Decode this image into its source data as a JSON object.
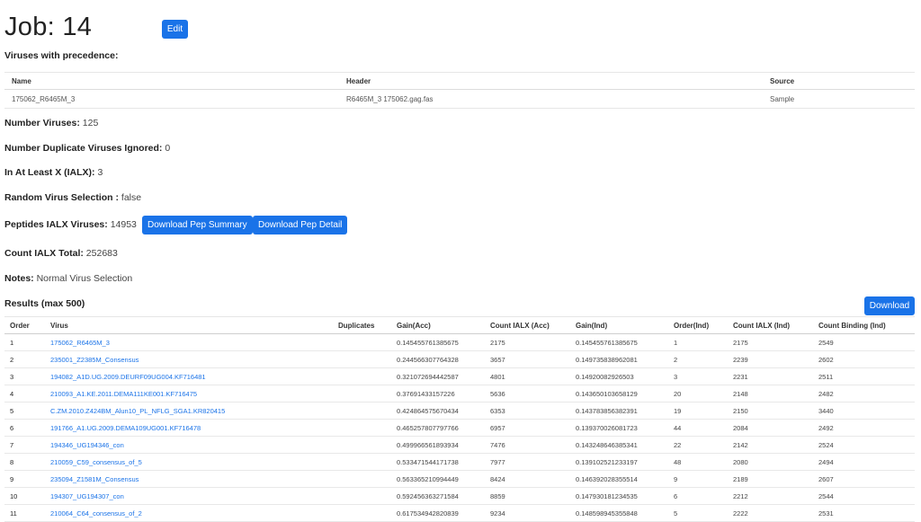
{
  "job": {
    "title": "Job: 14",
    "edit_label": "Edit"
  },
  "precedence": {
    "label": "Viruses with precedence:",
    "columns": [
      "Name",
      "Header",
      "Source"
    ],
    "rows": [
      {
        "name": "175062_R6465M_3",
        "header": "R6465M_3 175062.gag.fas",
        "source": "Sample"
      }
    ]
  },
  "stats": {
    "number_viruses": {
      "key": "Number Viruses:",
      "value": "125"
    },
    "duplicates_ignored": {
      "key": "Number Duplicate Viruses Ignored:",
      "value": "0"
    },
    "ialx": {
      "key": "In At Least X (IALX):",
      "value": "3"
    },
    "random_selection": {
      "key": "Random Virus Selection :",
      "value": "false"
    },
    "peptides": {
      "key": "Peptides IALX Viruses:",
      "value": "14953"
    },
    "count_ialx_total": {
      "key": "Count IALX Total:",
      "value": "252683"
    },
    "notes": {
      "key": "Notes:",
      "value": "Normal Virus Selection"
    }
  },
  "buttons": {
    "download_pep_summary": "Download Pep Summary",
    "download_pep_detail": "Download Pep Detail",
    "download": "Download"
  },
  "results": {
    "label": "Results (max 500)",
    "columns": [
      "Order",
      "Virus",
      "Duplicates",
      "Gain(Acc)",
      "Count IALX (Acc)",
      "Gain(Ind)",
      "Order(Ind)",
      "Count IALX (Ind)",
      "Count Binding (Ind)"
    ],
    "rows": [
      {
        "order": "1",
        "virus": "175062_R6465M_3",
        "duplicates": "",
        "gain_acc": "0.145455761385675",
        "count_acc": "2175",
        "gain_ind": "0.145455761385675",
        "order_ind": "1",
        "count_ind": "2175",
        "binding_ind": "2549"
      },
      {
        "order": "2",
        "virus": "235001_Z2385M_Consensus",
        "duplicates": "",
        "gain_acc": "0.244566307764328",
        "count_acc": "3657",
        "gain_ind": "0.149735838962081",
        "order_ind": "2",
        "count_ind": "2239",
        "binding_ind": "2602"
      },
      {
        "order": "3",
        "virus": "194082_A1D.UG.2009.DEURF09UG004.KF716481",
        "duplicates": "",
        "gain_acc": "0.321072694442587",
        "count_acc": "4801",
        "gain_ind": "0.14920082926503",
        "order_ind": "3",
        "count_ind": "2231",
        "binding_ind": "2511"
      },
      {
        "order": "4",
        "virus": "210093_A1.KE.2011.DEMA111KE001.KF716475",
        "duplicates": "",
        "gain_acc": "0.37691433157226",
        "count_acc": "5636",
        "gain_ind": "0.143650103658129",
        "order_ind": "20",
        "count_ind": "2148",
        "binding_ind": "2482"
      },
      {
        "order": "5",
        "virus": "C.ZM.2010.Z424BM_Alun10_PL_NFLG_SGA1.KR820415",
        "duplicates": "",
        "gain_acc": "0.424864575670434",
        "count_acc": "6353",
        "gain_ind": "0.143783856382391",
        "order_ind": "19",
        "count_ind": "2150",
        "binding_ind": "3440"
      },
      {
        "order": "6",
        "virus": "191766_A1.UG.2009.DEMA109UG001.KF716478",
        "duplicates": "",
        "gain_acc": "0.465257807797766",
        "count_acc": "6957",
        "gain_ind": "0.139370026081723",
        "order_ind": "44",
        "count_ind": "2084",
        "binding_ind": "2492"
      },
      {
        "order": "7",
        "virus": "194346_UG194346_con",
        "duplicates": "",
        "gain_acc": "0.499966561893934",
        "count_acc": "7476",
        "gain_ind": "0.143248646385341",
        "order_ind": "22",
        "count_ind": "2142",
        "binding_ind": "2524"
      },
      {
        "order": "8",
        "virus": "210059_C59_consensus_of_5",
        "duplicates": "",
        "gain_acc": "0.533471544171738",
        "count_acc": "7977",
        "gain_ind": "0.139102521233197",
        "order_ind": "48",
        "count_ind": "2080",
        "binding_ind": "2494"
      },
      {
        "order": "9",
        "virus": "235094_Z1581M_Consensus",
        "duplicates": "",
        "gain_acc": "0.563365210994449",
        "count_acc": "8424",
        "gain_ind": "0.146392028355514",
        "order_ind": "9",
        "count_ind": "2189",
        "binding_ind": "2607"
      },
      {
        "order": "10",
        "virus": "194307_UG194307_con",
        "duplicates": "",
        "gain_acc": "0.592456363271584",
        "count_acc": "8859",
        "gain_ind": "0.147930181234535",
        "order_ind": "6",
        "count_ind": "2212",
        "binding_ind": "2544"
      },
      {
        "order": "11",
        "virus": "210064_C64_consensus_of_2",
        "duplicates": "",
        "gain_acc": "0.617534942820839",
        "count_acc": "9234",
        "gain_ind": "0.148598945355848",
        "order_ind": "5",
        "count_ind": "2222",
        "binding_ind": "2531"
      }
    ]
  }
}
